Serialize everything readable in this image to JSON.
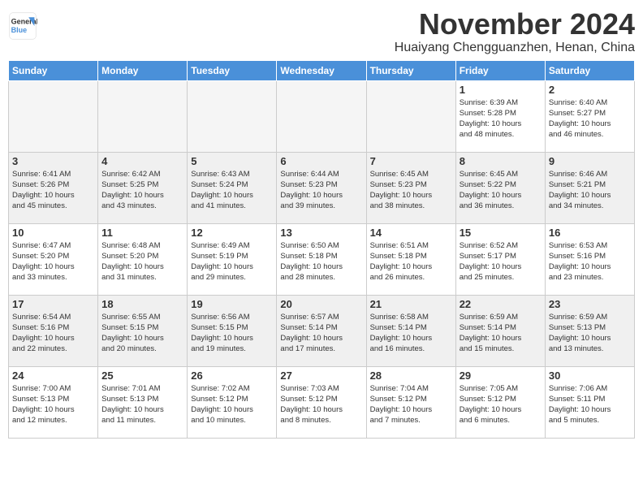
{
  "logo": {
    "general": "General",
    "blue": "Blue"
  },
  "title": "November 2024",
  "location": "Huaiyang Chengguanzhen, Henan, China",
  "weekdays": [
    "Sunday",
    "Monday",
    "Tuesday",
    "Wednesday",
    "Thursday",
    "Friday",
    "Saturday"
  ],
  "weeks": [
    [
      {
        "day": "",
        "info": "",
        "empty": true
      },
      {
        "day": "",
        "info": "",
        "empty": true
      },
      {
        "day": "",
        "info": "",
        "empty": true
      },
      {
        "day": "",
        "info": "",
        "empty": true
      },
      {
        "day": "",
        "info": "",
        "empty": true
      },
      {
        "day": "1",
        "info": "Sunrise: 6:39 AM\nSunset: 5:28 PM\nDaylight: 10 hours\nand 48 minutes."
      },
      {
        "day": "2",
        "info": "Sunrise: 6:40 AM\nSunset: 5:27 PM\nDaylight: 10 hours\nand 46 minutes."
      }
    ],
    [
      {
        "day": "3",
        "info": "Sunrise: 6:41 AM\nSunset: 5:26 PM\nDaylight: 10 hours\nand 45 minutes."
      },
      {
        "day": "4",
        "info": "Sunrise: 6:42 AM\nSunset: 5:25 PM\nDaylight: 10 hours\nand 43 minutes."
      },
      {
        "day": "5",
        "info": "Sunrise: 6:43 AM\nSunset: 5:24 PM\nDaylight: 10 hours\nand 41 minutes."
      },
      {
        "day": "6",
        "info": "Sunrise: 6:44 AM\nSunset: 5:23 PM\nDaylight: 10 hours\nand 39 minutes."
      },
      {
        "day": "7",
        "info": "Sunrise: 6:45 AM\nSunset: 5:23 PM\nDaylight: 10 hours\nand 38 minutes."
      },
      {
        "day": "8",
        "info": "Sunrise: 6:45 AM\nSunset: 5:22 PM\nDaylight: 10 hours\nand 36 minutes."
      },
      {
        "day": "9",
        "info": "Sunrise: 6:46 AM\nSunset: 5:21 PM\nDaylight: 10 hours\nand 34 minutes."
      }
    ],
    [
      {
        "day": "10",
        "info": "Sunrise: 6:47 AM\nSunset: 5:20 PM\nDaylight: 10 hours\nand 33 minutes."
      },
      {
        "day": "11",
        "info": "Sunrise: 6:48 AM\nSunset: 5:20 PM\nDaylight: 10 hours\nand 31 minutes."
      },
      {
        "day": "12",
        "info": "Sunrise: 6:49 AM\nSunset: 5:19 PM\nDaylight: 10 hours\nand 29 minutes."
      },
      {
        "day": "13",
        "info": "Sunrise: 6:50 AM\nSunset: 5:18 PM\nDaylight: 10 hours\nand 28 minutes."
      },
      {
        "day": "14",
        "info": "Sunrise: 6:51 AM\nSunset: 5:18 PM\nDaylight: 10 hours\nand 26 minutes."
      },
      {
        "day": "15",
        "info": "Sunrise: 6:52 AM\nSunset: 5:17 PM\nDaylight: 10 hours\nand 25 minutes."
      },
      {
        "day": "16",
        "info": "Sunrise: 6:53 AM\nSunset: 5:16 PM\nDaylight: 10 hours\nand 23 minutes."
      }
    ],
    [
      {
        "day": "17",
        "info": "Sunrise: 6:54 AM\nSunset: 5:16 PM\nDaylight: 10 hours\nand 22 minutes."
      },
      {
        "day": "18",
        "info": "Sunrise: 6:55 AM\nSunset: 5:15 PM\nDaylight: 10 hours\nand 20 minutes."
      },
      {
        "day": "19",
        "info": "Sunrise: 6:56 AM\nSunset: 5:15 PM\nDaylight: 10 hours\nand 19 minutes."
      },
      {
        "day": "20",
        "info": "Sunrise: 6:57 AM\nSunset: 5:14 PM\nDaylight: 10 hours\nand 17 minutes."
      },
      {
        "day": "21",
        "info": "Sunrise: 6:58 AM\nSunset: 5:14 PM\nDaylight: 10 hours\nand 16 minutes."
      },
      {
        "day": "22",
        "info": "Sunrise: 6:59 AM\nSunset: 5:14 PM\nDaylight: 10 hours\nand 15 minutes."
      },
      {
        "day": "23",
        "info": "Sunrise: 6:59 AM\nSunset: 5:13 PM\nDaylight: 10 hours\nand 13 minutes."
      }
    ],
    [
      {
        "day": "24",
        "info": "Sunrise: 7:00 AM\nSunset: 5:13 PM\nDaylight: 10 hours\nand 12 minutes."
      },
      {
        "day": "25",
        "info": "Sunrise: 7:01 AM\nSunset: 5:13 PM\nDaylight: 10 hours\nand 11 minutes."
      },
      {
        "day": "26",
        "info": "Sunrise: 7:02 AM\nSunset: 5:12 PM\nDaylight: 10 hours\nand 10 minutes."
      },
      {
        "day": "27",
        "info": "Sunrise: 7:03 AM\nSunset: 5:12 PM\nDaylight: 10 hours\nand 8 minutes."
      },
      {
        "day": "28",
        "info": "Sunrise: 7:04 AM\nSunset: 5:12 PM\nDaylight: 10 hours\nand 7 minutes."
      },
      {
        "day": "29",
        "info": "Sunrise: 7:05 AM\nSunset: 5:12 PM\nDaylight: 10 hours\nand 6 minutes."
      },
      {
        "day": "30",
        "info": "Sunrise: 7:06 AM\nSunset: 5:11 PM\nDaylight: 10 hours\nand 5 minutes."
      }
    ]
  ]
}
